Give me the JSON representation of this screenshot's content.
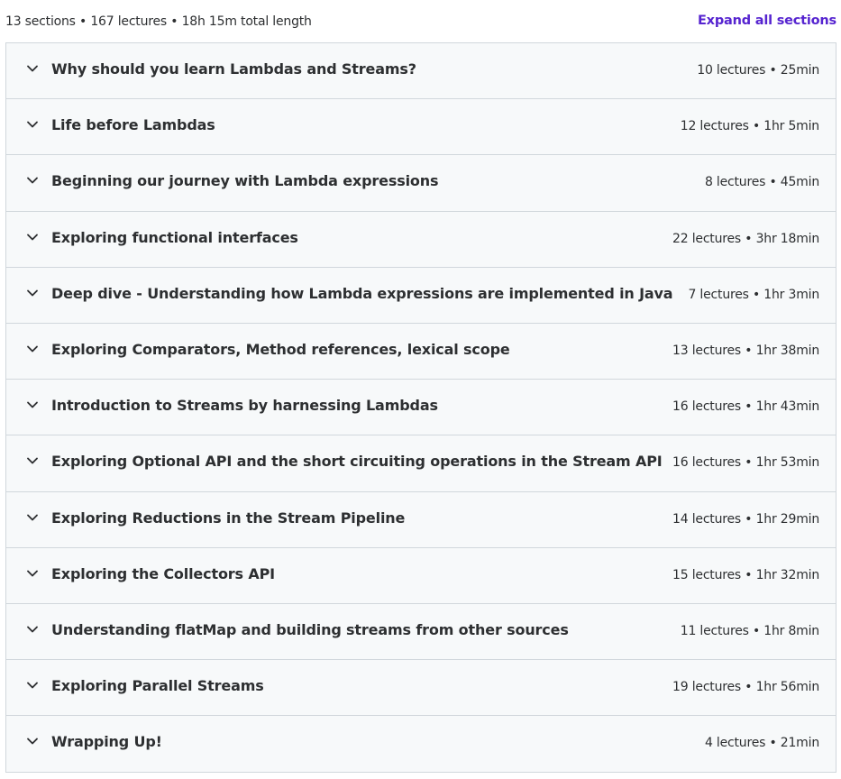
{
  "summary": {
    "text": "13 sections • 167 lectures • 18h 15m total length",
    "expand_label": "Expand all sections"
  },
  "colors": {
    "accent": "#5624d0",
    "section_bg": "#f7f9fa",
    "border": "#d1d7dc",
    "text": "#2d2f31"
  },
  "sections": [
    {
      "title": "Why should you learn Lambdas and Streams?",
      "meta": "10 lectures • 25min",
      "icon": "chevron-down-icon"
    },
    {
      "title": "Life before Lambdas",
      "meta": "12 lectures • 1hr 5min",
      "icon": "chevron-down-icon"
    },
    {
      "title": "Beginning our journey with Lambda expressions",
      "meta": "8 lectures • 45min",
      "icon": "chevron-down-icon"
    },
    {
      "title": "Exploring functional interfaces",
      "meta": "22 lectures • 3hr 18min",
      "icon": "chevron-down-icon"
    },
    {
      "title": "Deep dive - Understanding how Lambda expressions are implemented in Java",
      "meta": "7 lectures • 1hr 3min",
      "icon": "chevron-down-icon"
    },
    {
      "title": "Exploring Comparators, Method references, lexical scope",
      "meta": "13 lectures • 1hr 38min",
      "icon": "chevron-down-icon"
    },
    {
      "title": "Introduction to Streams by harnessing Lambdas",
      "meta": "16 lectures • 1hr 43min",
      "icon": "chevron-down-icon"
    },
    {
      "title": "Exploring Optional API and the short circuiting operations in the Stream API",
      "meta": "16 lectures • 1hr 53min",
      "icon": "chevron-down-icon"
    },
    {
      "title": "Exploring Reductions in the Stream Pipeline",
      "meta": "14 lectures • 1hr 29min",
      "icon": "chevron-down-icon"
    },
    {
      "title": "Exploring the Collectors API",
      "meta": "15 lectures • 1hr 32min",
      "icon": "chevron-down-icon"
    },
    {
      "title": "Understanding flatMap and building streams from other sources",
      "meta": "11 lectures • 1hr 8min",
      "icon": "chevron-down-icon"
    },
    {
      "title": "Exploring Parallel Streams",
      "meta": "19 lectures • 1hr 56min",
      "icon": "chevron-down-icon"
    },
    {
      "title": "Wrapping Up!",
      "meta": "4 lectures • 21min",
      "icon": "chevron-down-icon"
    }
  ]
}
